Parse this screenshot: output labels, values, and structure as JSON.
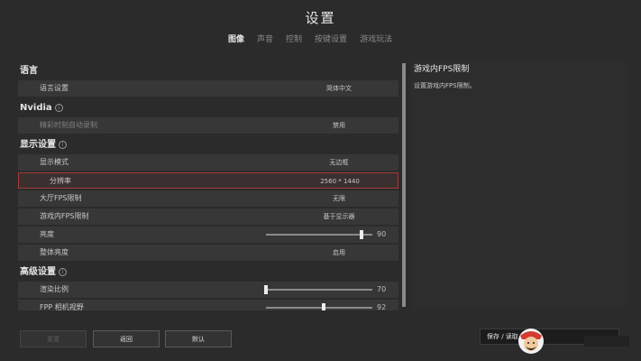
{
  "header": {
    "title": "设置"
  },
  "tabs": [
    {
      "label": "图像"
    },
    {
      "label": "声音"
    },
    {
      "label": "控制"
    },
    {
      "label": "按键设置"
    },
    {
      "label": "游戏玩法"
    }
  ],
  "sections": {
    "language": {
      "title": "语言",
      "rows": [
        {
          "label": "语言设置",
          "value": "简体中文"
        }
      ]
    },
    "nvidia": {
      "title": "Nvidia",
      "rows": [
        {
          "label": "精彩时刻自动录制",
          "value": "禁用"
        }
      ]
    },
    "display": {
      "title": "显示设置",
      "rows": [
        {
          "label": "显示模式",
          "value": "无边框"
        },
        {
          "label": "分辨率",
          "value": "2560 * 1440"
        },
        {
          "label": "大厅FPS限制",
          "value": "无限"
        },
        {
          "label": "游戏内FPS限制",
          "value": "基于显示器"
        },
        {
          "label": "亮度",
          "value": "90",
          "level": 0.9
        },
        {
          "label": "整体亮度",
          "value": "启用"
        }
      ]
    },
    "advanced": {
      "title": "高级设置",
      "rows": [
        {
          "label": "渲染比例",
          "value": "70",
          "level": 0.0
        },
        {
          "label": "FPP 相机视野",
          "value": "92",
          "level": 0.54
        }
      ]
    }
  },
  "detail": {
    "title": "游戏内FPS限制",
    "description": "设置游戏内FPS限制。"
  },
  "buttons": {
    "reset": "重置",
    "back": "返回",
    "default": "默认"
  },
  "save_bar": {
    "label": "保存 / 读取"
  },
  "colors": {
    "highlight": "#a33b36",
    "background": "#2b2b2b"
  }
}
